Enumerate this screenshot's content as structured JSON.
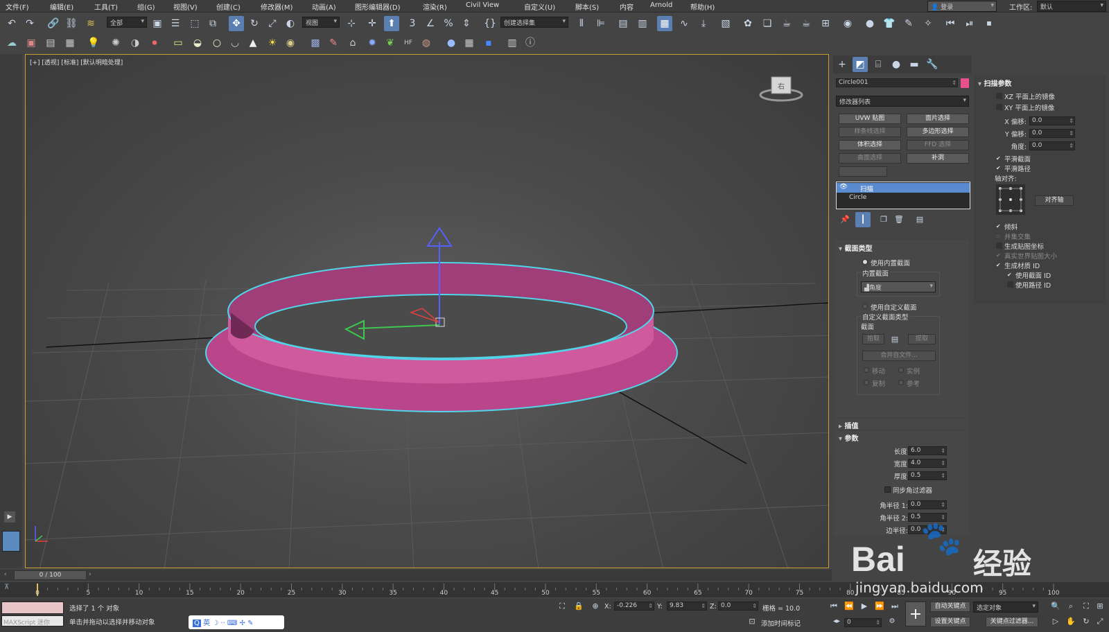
{
  "menu": [
    "文件(F)",
    "编辑(E)",
    "工具(T)",
    "组(G)",
    "视图(V)",
    "创建(C)",
    "修改器(M)",
    "动画(A)",
    "图形编辑器(D)",
    "渲染(R)",
    "Civil View",
    "自定义(U)",
    "脚本(S)",
    "内容",
    "Arnold",
    "帮助(H)"
  ],
  "login_label": "登录",
  "workspace_label": "工作区:",
  "workspace_value": "默认",
  "toolbar": {
    "filter_value": "全部",
    "ref_coord_value": "视图",
    "selection_set_value": "创建选择集"
  },
  "viewport": {
    "label": "[+] [透视] [标准] [默认明暗处理]",
    "viewcube_label": "右",
    "object_color": "#c44a8f",
    "selection_color": "#4fd6e8"
  },
  "panel": {
    "object_name": "Circle001",
    "object_color": "#e8508f",
    "modifier_list": "修改器列表",
    "mod_buttons": [
      {
        "label": "UVW 贴图",
        "enabled": true
      },
      {
        "label": "面片选择",
        "enabled": true
      },
      {
        "label": "样条线选择",
        "enabled": false
      },
      {
        "label": "多边形选择",
        "enabled": true
      },
      {
        "label": "体积选择",
        "enabled": true
      },
      {
        "label": "FFD 选择",
        "enabled": false
      },
      {
        "label": "曲面选择",
        "enabled": false
      },
      {
        "label": "补洞",
        "enabled": true
      }
    ],
    "stack": [
      "扫描",
      "Circle"
    ],
    "section_type": {
      "title": "截面类型",
      "use_builtin": "使用内置截面",
      "builtin_group": "内置截面",
      "builtin_value": "角度",
      "use_custom": "使用自定义截面",
      "custom_group": "自定义截面类型",
      "section_label": "截面",
      "pick": "拾取",
      "extract": "提取",
      "merge": "合并自文件...",
      "move": "移动",
      "instance": "实例",
      "copy": "复制",
      "reference": "参考"
    },
    "interp_title": "插值",
    "params": {
      "title": "参数",
      "length_label": "长度:",
      "length": "6.0",
      "width_label": "宽度:",
      "width": "4.0",
      "thickness_label": "厚度:",
      "thickness": "0.5",
      "sync_label": "同步角过滤器",
      "r1_label": "角半径 1:",
      "r1": "0.0",
      "r2_label": "角半径 2:",
      "r2": "0.5",
      "edge_label": "边半径:",
      "edge": "0.0"
    }
  },
  "sweep_params": {
    "title": "扫描参数",
    "mirror_xz": "XZ 平面上的镜像",
    "mirror_xy": "XY 平面上的镜像",
    "x_offset_label": "X 偏移:",
    "x_offset": "0.0",
    "y_offset_label": "Y 偏移:",
    "y_offset": "0.0",
    "angle_label": "角度:",
    "angle": "0.0",
    "smooth_section": "平滑截面",
    "smooth_path": "平滑路径",
    "pivot_align": "轴对齐:",
    "align_pivot_btn": "对齐轴",
    "banking": "倾斜",
    "union": "并集交集",
    "gen_map": "生成贴图坐标",
    "real_world": "真实世界贴图大小",
    "gen_mat": "生成材质 ID",
    "use_section_id": "使用截面 ID",
    "use_path_id": "使用路径 ID"
  },
  "timeline": {
    "frame": "0 / 100",
    "ticks": [
      "0",
      "5",
      "10",
      "15",
      "20",
      "25",
      "30",
      "35",
      "40",
      "45",
      "50",
      "55",
      "60",
      "65",
      "70",
      "75",
      "80",
      "85",
      "90",
      "95",
      "100"
    ]
  },
  "status": {
    "maxscript": "MAXScript 迷你",
    "selected": "选择了 1 个 对象",
    "hint": "单击并拖动以选择并移动对象",
    "ime": "英",
    "x_label": "X:",
    "x": "-0.226",
    "y_label": "Y:",
    "y": "9.83",
    "z_label": "Z:",
    "z": "0.0",
    "grid": "栅格 = 10.0",
    "add_time_tag": "添加时间标记",
    "auto_key": "自动关键点",
    "set_key": "设置关键点",
    "selected_obj": "选定对象",
    "key_filter": "关键点过滤器...",
    "frame_value": "0"
  },
  "watermark": {
    "brand": "Bai",
    "brand2": "经验",
    "url": "jingyan.baidu.com"
  }
}
